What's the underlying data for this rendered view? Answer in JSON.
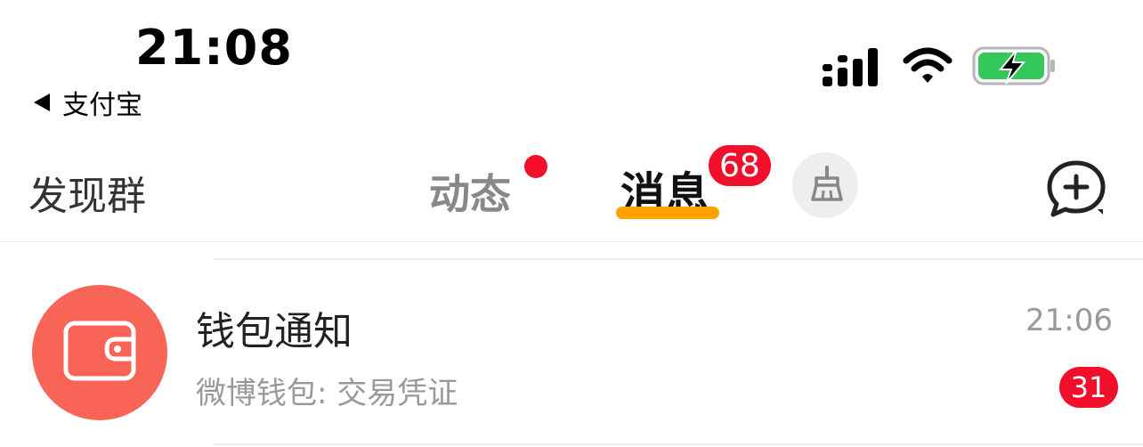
{
  "status_bar": {
    "time": "21:08",
    "back_app": "支付宝",
    "signal_icon": "cellular-signal-icon",
    "wifi_icon": "wifi-icon",
    "battery_icon": "battery-charging-icon",
    "battery_color": "#34c759"
  },
  "nav": {
    "discover_label": "发现群",
    "tabs": [
      {
        "label": "动态",
        "has_dot": true
      },
      {
        "label": "消息",
        "badge": "68",
        "active": true
      }
    ],
    "clean_icon": "broom-icon",
    "compose_icon": "chat-plus-icon",
    "accent_color": "#ffa200",
    "badge_color": "#f20f2b"
  },
  "messages": [
    {
      "title": "钱包通知",
      "subtitle": "微博钱包: 交易凭证",
      "time": "21:06",
      "unread": "31",
      "avatar_icon": "wallet-icon",
      "avatar_color": "#f86455"
    }
  ]
}
